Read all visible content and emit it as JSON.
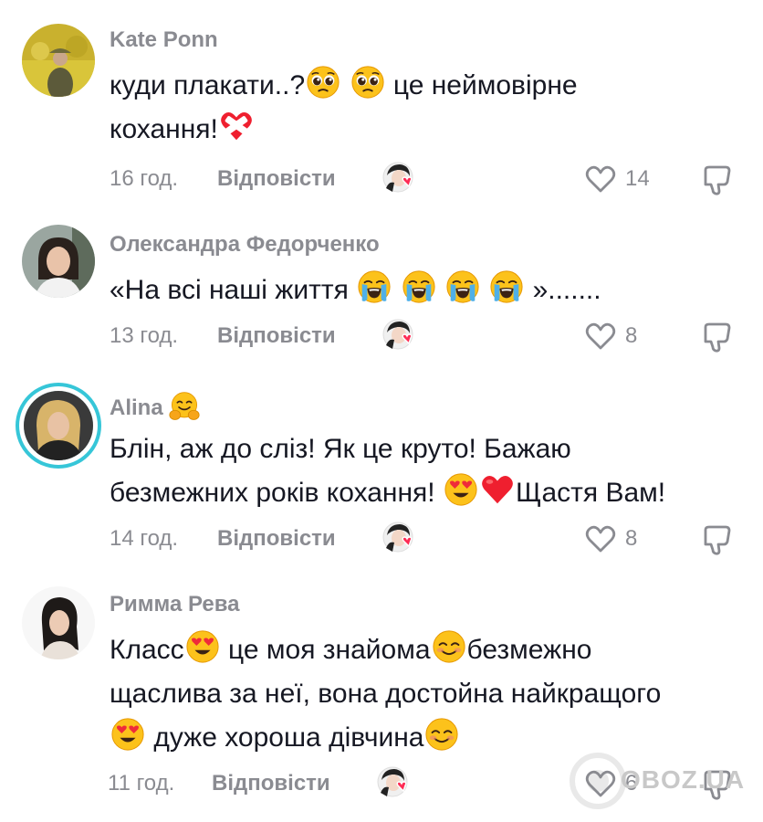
{
  "common": {
    "reply_label": "Відповісти",
    "colors": {
      "username": "#8a8b91",
      "text": "#161823",
      "story_ring": "#36c6d8",
      "creator_heart": "#fe2c55"
    }
  },
  "comments": [
    {
      "username": "Kate Ponn",
      "text_parts": [
        "куди плакати..?",
        "це неймовірне",
        "кохання!"
      ],
      "time": "16 год.",
      "likes": "14",
      "icons": [
        "pleading-face-emoji",
        "pleading-face-emoji",
        "mending-heart-emoji"
      ]
    },
    {
      "username": "Олександра Федорченко",
      "text_parts": [
        "«На всі наші життя",
        "»......."
      ],
      "time": "13 год.",
      "likes": "8",
      "icons": [
        "loudly-crying-face-emoji",
        "loudly-crying-face-emoji",
        "loudly-crying-face-emoji",
        "loudly-crying-face-emoji"
      ]
    },
    {
      "username": "Alina",
      "text_parts": [
        "Блін, аж до сліз! Як це круто! Бажаю",
        "безмежних років кохання!",
        "Щастя Вам!"
      ],
      "time": "14 год.",
      "likes": "8",
      "icons": [
        "hugging-face-emoji",
        "heart-eyes-emoji",
        "red-heart-emoji"
      ]
    },
    {
      "username": "Римма Рева",
      "text_parts": [
        "Класс",
        "це моя знайома",
        "безмежно",
        "щаслива за неї, вона достойна найкращого",
        "дуже хороша дівчина"
      ],
      "time": "11 год.",
      "likes": "6",
      "icons": [
        "heart-eyes-emoji",
        "smiling-face-emoji",
        "heart-eyes-emoji",
        "smiling-face-emoji"
      ]
    }
  ],
  "watermark": {
    "text": "OBOZ.UA",
    "icon": "oboz-logo"
  }
}
